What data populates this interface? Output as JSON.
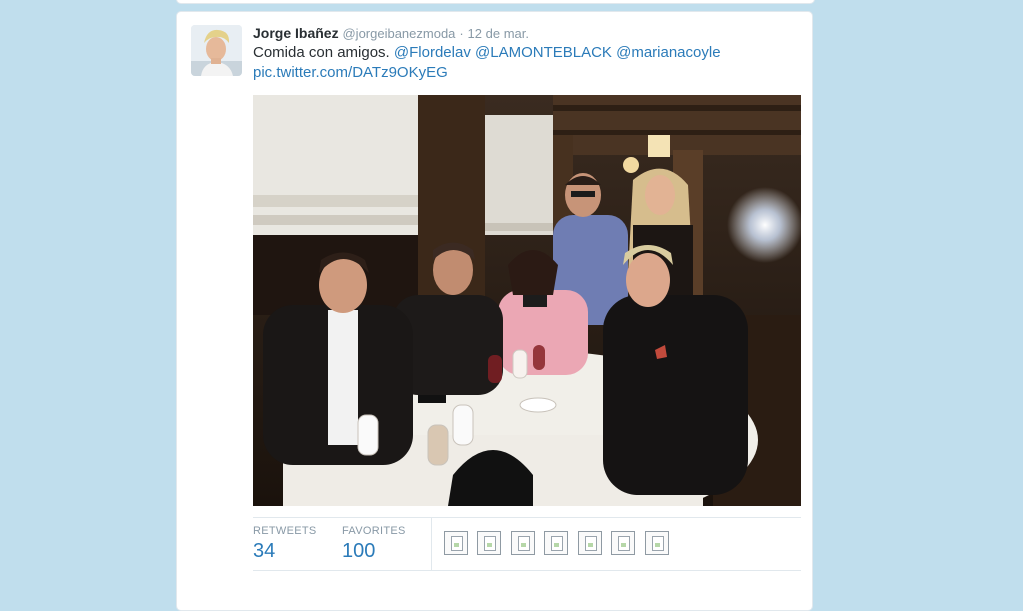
{
  "tweet": {
    "fullname": "Jorge Ibañez",
    "username": "@jorgeibanezmoda",
    "separator": "·",
    "time": "12 de mar.",
    "text": "Comida con amigos.",
    "mentions": [
      "@Flordelav",
      "@LAMONTEBLACK",
      "@marianacoyle"
    ],
    "link": "pic.twitter.com/DATz9OKyEG"
  },
  "stats": {
    "retweets_label": "RETWEETS",
    "retweets_value": "34",
    "favorites_label": "FAVORITES",
    "favorites_value": "100"
  },
  "favoriters_count_shown": 7,
  "colors": {
    "background": "#c0deed",
    "link": "#2b7bb9",
    "muted": "#8899a6",
    "text": "#292f33"
  }
}
